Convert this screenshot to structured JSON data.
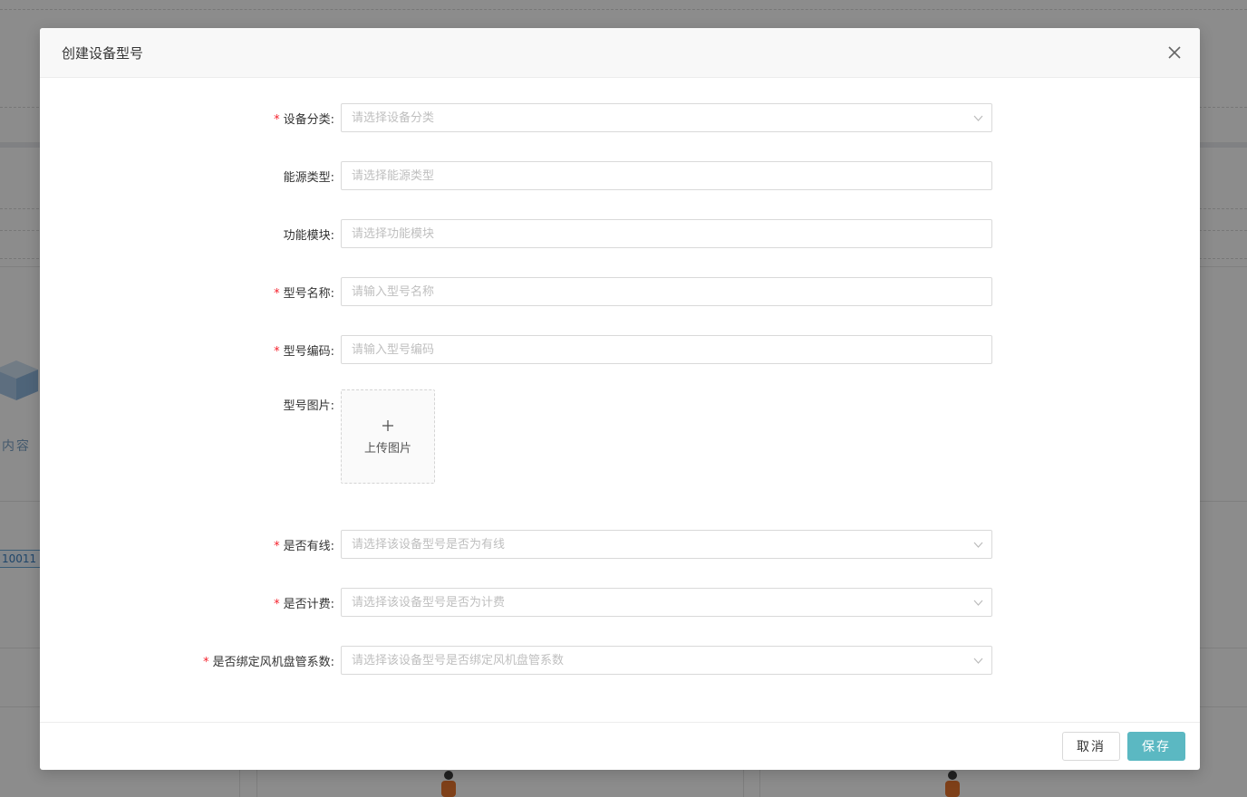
{
  "background": {
    "content_label": "内容",
    "tag_text": "10011"
  },
  "dialog": {
    "title": "创建设备型号",
    "close_icon": "close-icon"
  },
  "form": {
    "fields": [
      {
        "label": "设备分类:",
        "required": true,
        "placeholder": "请选择设备分类",
        "kind": "select"
      },
      {
        "label": "能源类型:",
        "required": false,
        "placeholder": "请选择能源类型",
        "kind": "input"
      },
      {
        "label": "功能模块:",
        "required": false,
        "placeholder": "请选择功能模块",
        "kind": "input"
      },
      {
        "label": "型号名称:",
        "required": true,
        "placeholder": "请输入型号名称",
        "kind": "input"
      },
      {
        "label": "型号编码:",
        "required": true,
        "placeholder": "请输入型号编码",
        "kind": "input"
      },
      {
        "label": "型号图片:",
        "required": false,
        "kind": "upload",
        "upload_text": "上传图片"
      },
      {
        "label": "是否有线:",
        "required": true,
        "placeholder": "请选择该设备型号是否为有线",
        "kind": "select"
      },
      {
        "label": "是否计费:",
        "required": true,
        "placeholder": "请选择该设备型号是否为计费",
        "kind": "select"
      },
      {
        "label": "是否绑定风机盘管系数:",
        "required": true,
        "placeholder": "请选择该设备型号是否绑定风机盘管系数",
        "kind": "select"
      }
    ],
    "required_mark": "*"
  },
  "footer": {
    "cancel_label": "取消",
    "save_label": "保存"
  },
  "colors": {
    "primary": "#5bb8c2",
    "required": "#f5222d",
    "placeholder": "#bfbfbf"
  }
}
